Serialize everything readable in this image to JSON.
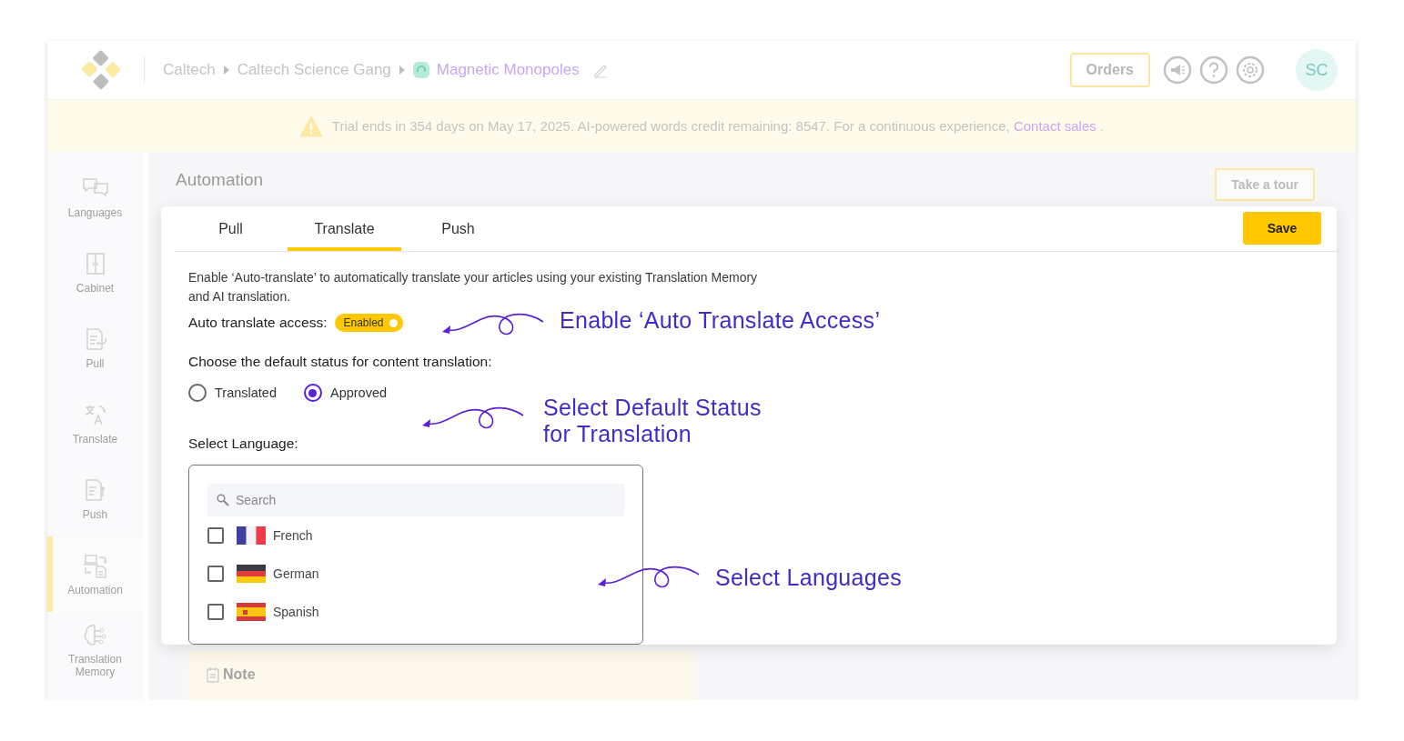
{
  "header": {
    "breadcrumbs": [
      {
        "label": "Caltech",
        "kind": "plain"
      },
      {
        "label": "Caltech Science Gang",
        "kind": "plain"
      },
      {
        "label": "Magnetic Monopoles",
        "kind": "project"
      }
    ],
    "orders_button": "Orders",
    "avatar": "SC"
  },
  "banner": {
    "text": "Trial ends in 354 days on May 17, 2025. AI-powered words credit remaining: 8547. For a continuous experience,",
    "link": "Contact sales",
    "tail": "."
  },
  "sidebar": {
    "items": [
      {
        "label": "Languages",
        "selected": false
      },
      {
        "label": "Cabinet",
        "selected": false
      },
      {
        "label": "Pull",
        "selected": false
      },
      {
        "label": "Translate",
        "selected": false
      },
      {
        "label": "Push",
        "selected": false
      },
      {
        "label": "Automation",
        "selected": true
      },
      {
        "label": "Translation Memory",
        "selected": false
      }
    ]
  },
  "page": {
    "title": "Automation",
    "tour_button": "Take a tour"
  },
  "card": {
    "tabs": [
      {
        "label": "Pull",
        "selected": false
      },
      {
        "label": "Translate",
        "selected": true
      },
      {
        "label": "Push",
        "selected": false
      }
    ],
    "save_button": "Save",
    "description": "Enable ‘Auto-translate’ to automatically translate your articles using your existing Translation Memory and AI translation.",
    "access_label": "Auto translate access:",
    "toggle": {
      "label": "Enabled",
      "on": true
    },
    "status_question": "Choose the default status for content translation:",
    "status_options": [
      {
        "label": "Translated",
        "selected": false
      },
      {
        "label": "Approved",
        "selected": true
      }
    ],
    "language_label": "Select Language:",
    "search": {
      "placeholder": "Search"
    },
    "languages": [
      {
        "name": "French",
        "kind": "french",
        "checked": false
      },
      {
        "name": "German",
        "kind": "german",
        "checked": false
      },
      {
        "name": "Spanish",
        "kind": "spanish",
        "checked": false
      }
    ],
    "annotations": [
      "Enable ‘Auto Translate Access’",
      "Select Default Status for Translation",
      "Select Languages"
    ]
  },
  "note": {
    "title": "Note"
  }
}
